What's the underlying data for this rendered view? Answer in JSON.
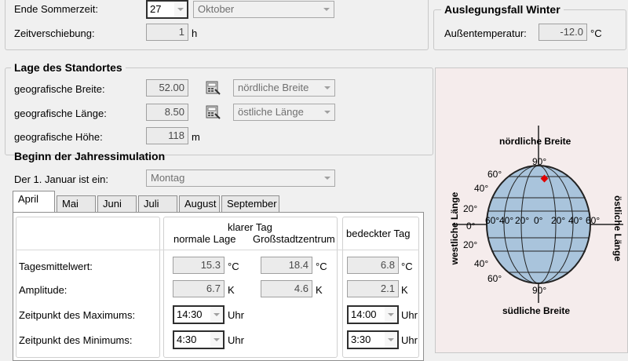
{
  "top": {
    "ende_label": "Ende Sommerzeit:",
    "ende_day": "27",
    "ende_month": "Oktober",
    "verschiebung_label": "Zeitverschiebung:",
    "verschiebung_value": "1",
    "verschiebung_unit": "h"
  },
  "winter": {
    "title": "Auslegungsfall Winter",
    "temp_label": "Außentemperatur:",
    "temp_value": "-12.0",
    "temp_unit": "°C"
  },
  "location": {
    "title": "Lage des Standortes",
    "breite_label": "geografische Breite:",
    "breite_value": "52.00",
    "breite_dir": "nördliche Breite",
    "laenge_label": "geografische Länge:",
    "laenge_value": "8.50",
    "laenge_dir": "östliche Länge",
    "hoehe_label": "geografische Höhe:",
    "hoehe_value": "118",
    "hoehe_unit": "m"
  },
  "sim": {
    "title": "Beginn der Jahressimulation",
    "jan_label": "Der 1. Januar ist ein:",
    "jan_value": "Montag"
  },
  "tabs": [
    {
      "label": "April"
    },
    {
      "label": "Mai"
    },
    {
      "label": "Juni"
    },
    {
      "label": "Juli"
    },
    {
      "label": "August"
    },
    {
      "label": "September"
    }
  ],
  "table": {
    "klarer_tag": "klarer Tag",
    "normale_lage": "normale Lage",
    "grossstadt": "Großstadtzentrum",
    "bedeckt": "bedeckter Tag",
    "tagesmittel_label": "Tagesmittelwert:",
    "amplitude_label": "Amplitude:",
    "max_label": "Zeitpunkt des Maximums:",
    "min_label": "Zeitpunkt des Minimums:",
    "normal_mittel": "15.3",
    "normal_amp": "6.7",
    "normal_max": "14:30",
    "normal_min": "4:30",
    "stadt_mittel": "18.4",
    "stadt_amp": "4.6",
    "bedeckt_mittel": "6.8",
    "bedeckt_amp": "2.1",
    "bedeckt_max": "14:00",
    "bedeckt_min": "3:30",
    "unit_c": "°C",
    "unit_k": "K",
    "unit_uhr": "Uhr"
  },
  "globe": {
    "north": "nördliche Breite",
    "south": "südliche Breite",
    "west": "westliche Länge",
    "east": "östliche Länge",
    "lat_top": "90°",
    "lat_bottom": "90°",
    "lat_left": [
      "60°",
      "40°",
      "20°",
      "0°",
      "20°",
      "40°",
      "60°"
    ],
    "lon_labels": [
      "60°",
      "40°",
      "20°",
      "0°",
      "20°",
      "40°",
      "60°"
    ],
    "marker_color": "#e00000",
    "globe_color": "#a9c4dc"
  }
}
